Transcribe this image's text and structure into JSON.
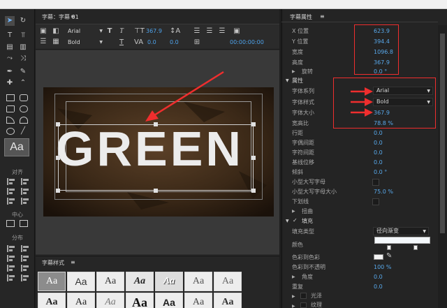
{
  "title_panel": {
    "tab_title": "字幕：字幕 01",
    "tab_menu_icon": "hamburger-menu-icon"
  },
  "toolbar": {
    "font_family": "Arial",
    "font_style": "Bold",
    "font_size": "367.9",
    "kerning": "0.0",
    "leading": "0.0",
    "timecode": "00:00:00:00"
  },
  "tools": {
    "section_align": "对齐",
    "section_center": "中心",
    "section_distribute": "分布",
    "style_preview": "Aa"
  },
  "canvas": {
    "text": "GREEN"
  },
  "styles_panel": {
    "title": "字幕样式",
    "swatches": [
      "Aa",
      "Aa",
      "Aa",
      "Aa",
      "Aa",
      "Aa",
      "Aa",
      "Aa",
      "Aa",
      "Aa",
      "Aa",
      "Aa",
      "Aa",
      "Aa"
    ]
  },
  "properties": {
    "title": "字幕属性",
    "menu_icon": "hamburger-menu-icon",
    "rows": [
      {
        "label": "X 位置",
        "value": "623.9"
      },
      {
        "label": "Y 位置",
        "value": "394.4"
      },
      {
        "label": "宽度",
        "value": "1096.8"
      },
      {
        "label": "高度",
        "value": "367.9"
      },
      {
        "label": "旋转",
        "value": "0.0 °"
      }
    ],
    "section_attributes": "属性",
    "font_family_label": "字体系列",
    "font_family_value": "Arial",
    "font_style_label": "字体样式",
    "font_style_value": "Bold",
    "font_size_label": "字体大小",
    "font_size_value": "367.9",
    "aspect_label": "宽高比",
    "aspect_value": "78.8 %",
    "more_rows": [
      {
        "label": "行距",
        "value": "0.0"
      },
      {
        "label": "字偶间距",
        "value": "0.0"
      },
      {
        "label": "字符间距",
        "value": "0.0"
      },
      {
        "label": "基线位移",
        "value": "0.0"
      },
      {
        "label": "倾斜",
        "value": "0.0 °"
      }
    ],
    "small_caps_label": "小型大写字母",
    "small_caps_size_label": "小型大写字母大小",
    "small_caps_size_value": "75.0 %",
    "underline_label": "下划线",
    "distort_label": "扭曲",
    "fill_label": "填充",
    "fill_type_label": "填充类型",
    "fill_type_value": "径向渐变",
    "color_label": "颜色",
    "color_to_color_label": "色彩到色彩",
    "color_opacity_label": "色彩到不透明",
    "color_opacity_value": "100 %",
    "angle_label": "角度",
    "angle_value": "0.0",
    "repeat_label": "重复",
    "repeat_value": "0.0",
    "gloss_label": "光泽",
    "texture_label": "纹理"
  },
  "colors": {
    "accent_blue": "#58a8ea",
    "highlight_red": "#ef2e2e"
  }
}
